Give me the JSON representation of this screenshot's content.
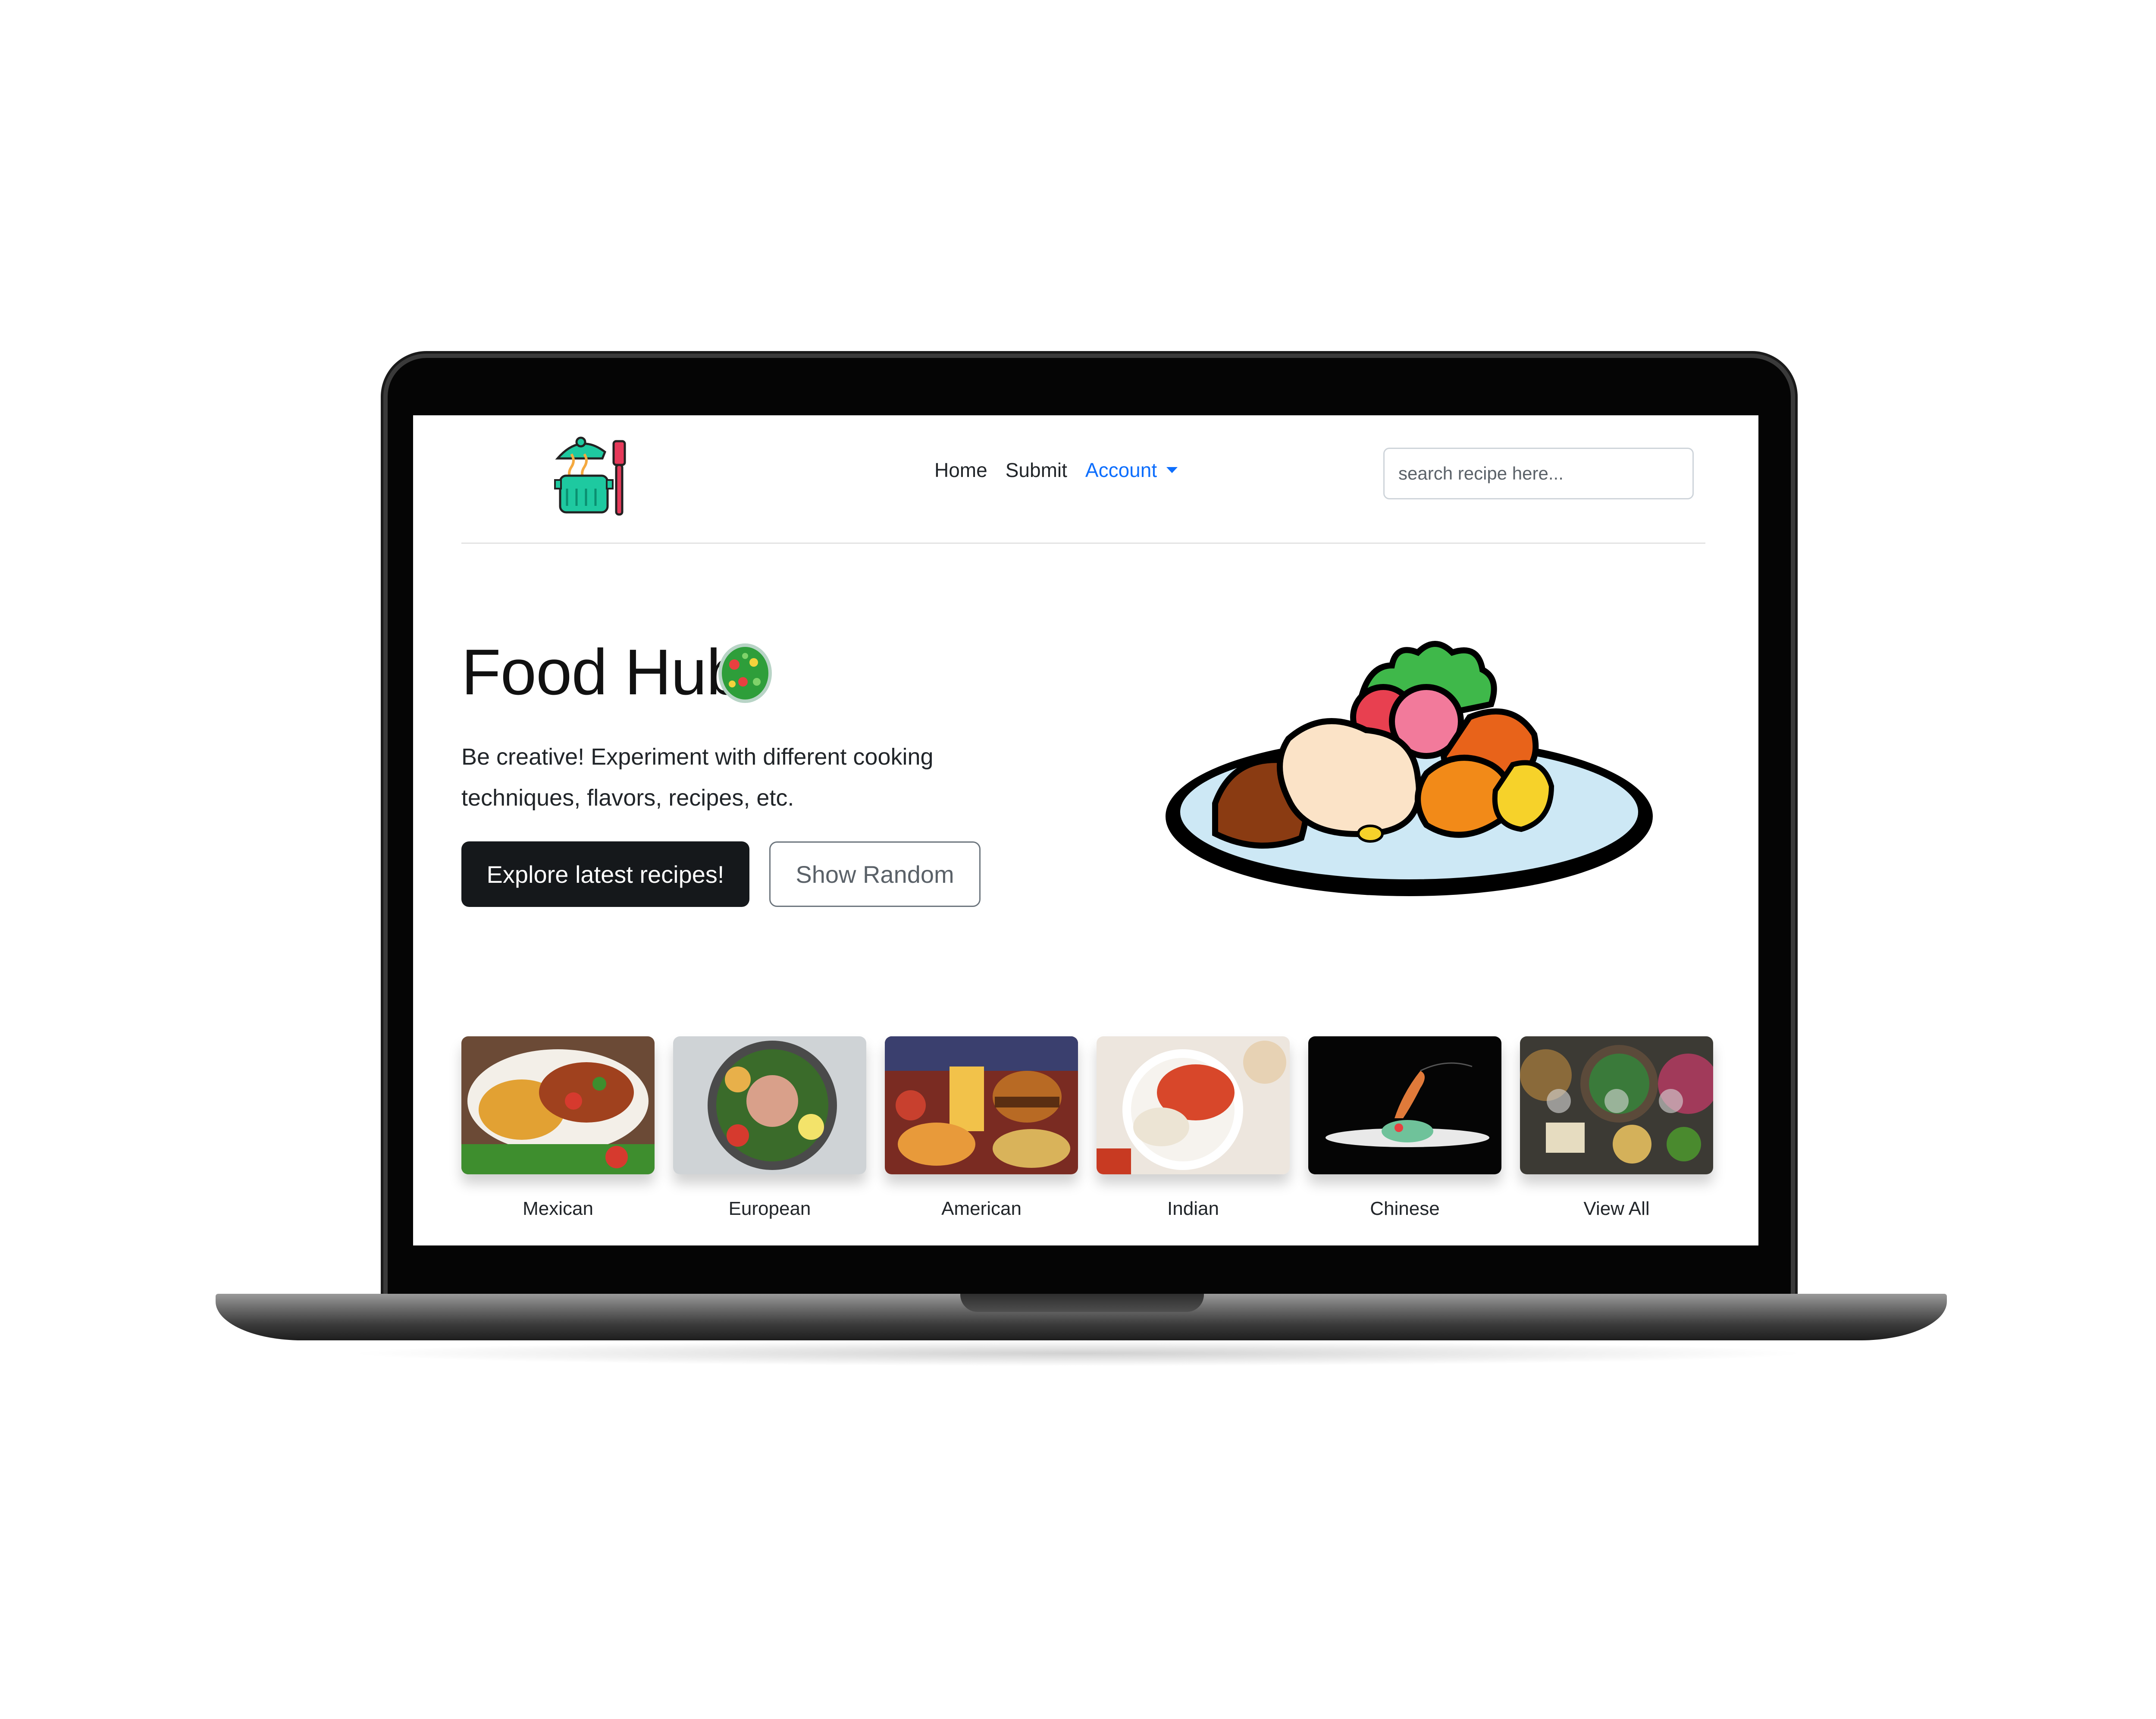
{
  "nav": {
    "links": [
      "Home",
      "Submit"
    ],
    "account_label": "Account",
    "search_placeholder": "search recipe here..."
  },
  "hero": {
    "title": "Food Hub",
    "description": "Be creative! Experiment with different cooking techniques, flavors, recipes, etc.",
    "primary_button": "Explore latest recipes!",
    "secondary_button": "Show Random"
  },
  "categories": [
    {
      "label": "Mexican"
    },
    {
      "label": "European"
    },
    {
      "label": "American"
    },
    {
      "label": "Indian"
    },
    {
      "label": "Chinese"
    },
    {
      "label": "View All"
    }
  ],
  "colors": {
    "account_link": "#0d6efd",
    "primary_button_bg": "#15181b",
    "outline_button_border": "#6c757d"
  }
}
